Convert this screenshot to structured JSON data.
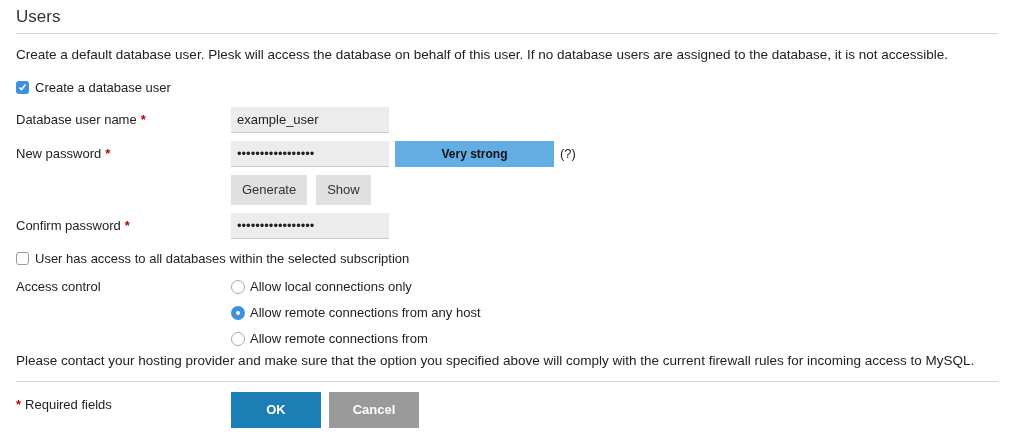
{
  "section": {
    "title": "Users"
  },
  "description": "Create a default database user. Plesk will access the database on behalf of this user. If no database users are assigned to the database, it is not accessible.",
  "create_user": {
    "label": "Create a database user",
    "checked": true
  },
  "fields": [
    {
      "label": "Database user name",
      "required_mark": "*",
      "value": "example_user"
    },
    {
      "label": "New password",
      "required_mark": "*",
      "value": "•••••••••••••••••",
      "strength": {
        "label": "Very strong",
        "level": 1
      },
      "help": "(?)",
      "buttons": [
        "Generate",
        "Show"
      ]
    },
    {
      "label": "Confirm password",
      "required_mark": "*",
      "value": "•••••••••••••••••"
    }
  ],
  "all_databases": {
    "label": "User has access to all databases within the selected subscription",
    "checked": false
  },
  "access_control": {
    "label": "Access control",
    "options": [
      {
        "label": "Allow local connections only",
        "selected": false
      },
      {
        "label": "Allow remote connections from any host",
        "selected": true
      },
      {
        "label": "Allow remote connections from",
        "selected": false
      }
    ]
  },
  "note": "Please contact your hosting provider and make sure that the option you specified above will comply with the current firewall rules for incoming access to MySQL.",
  "footer": {
    "mark": "*",
    "text": "Required fields",
    "buttons": [
      {
        "label": "OK",
        "kind": "primary"
      },
      {
        "label": "Cancel",
        "kind": "secondary"
      }
    ]
  }
}
